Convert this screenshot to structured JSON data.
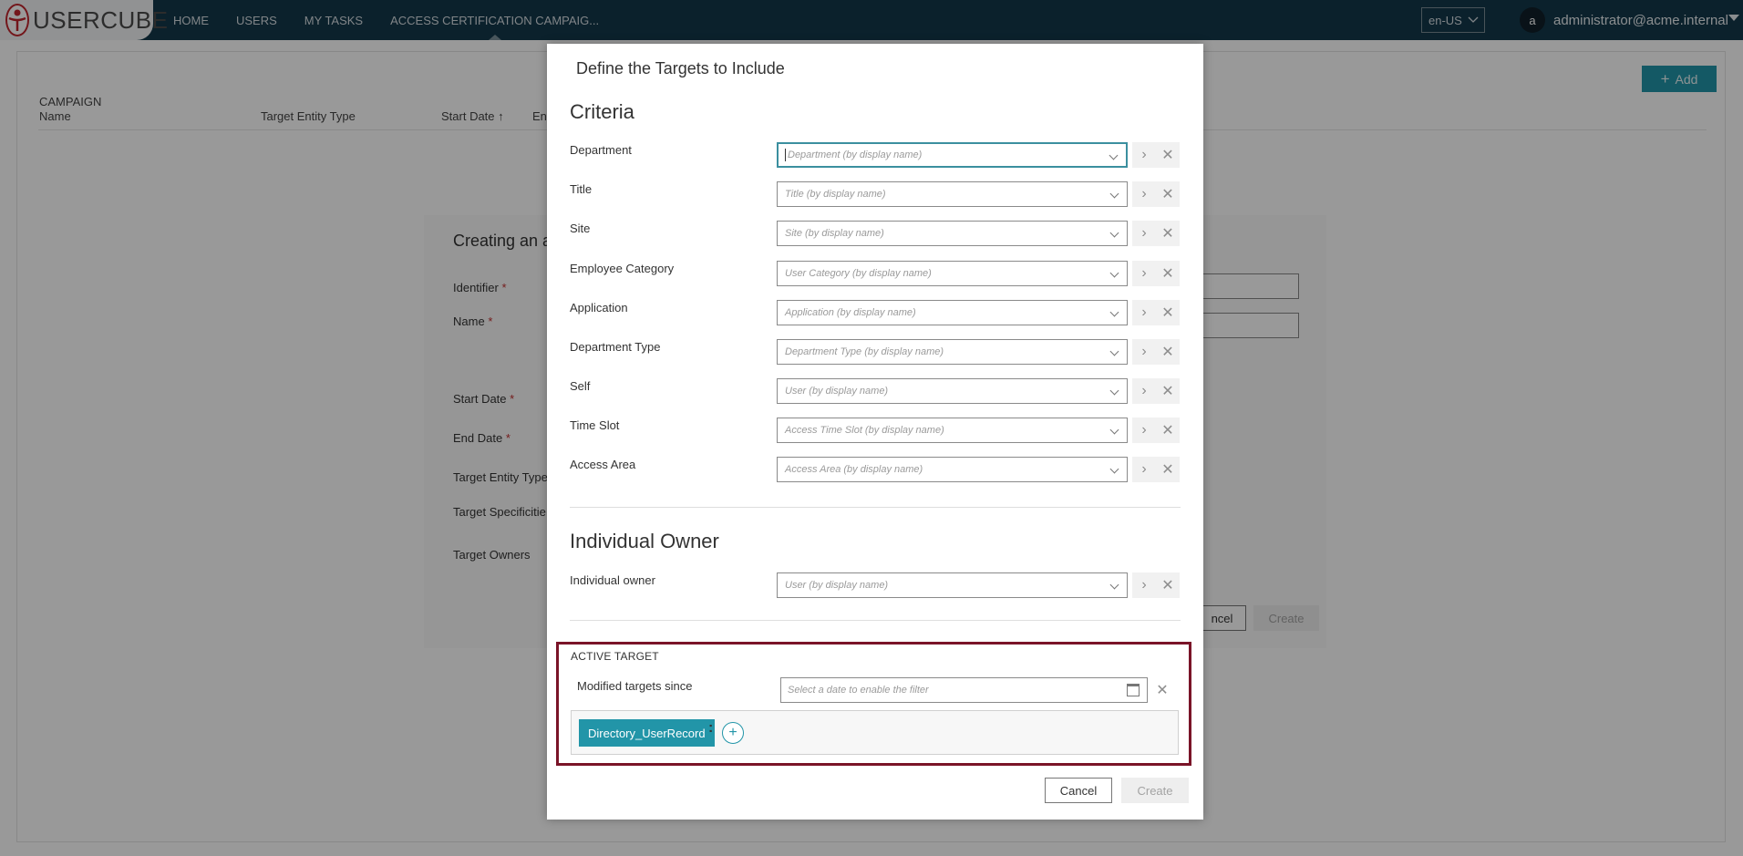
{
  "topbar": {
    "logo_text": "USERCUBE",
    "nav": [
      "HOME",
      "USERS",
      "MY TASKS",
      "ACCESS CERTIFICATION CAMPAIG..."
    ],
    "language": "en-US",
    "avatar_initial": "a",
    "user": "administrator@acme.internal"
  },
  "background": {
    "add_label": "Add",
    "campaign_header": "CAMPAIGN",
    "columns": [
      "Name",
      "Target Entity Type",
      "Start Date",
      "En"
    ],
    "sort_indicator": "↑"
  },
  "middle_dialog": {
    "title": "Creating an a",
    "labels": [
      "Identifier",
      "Name",
      "Start Date",
      "End Date",
      "Target Entity Type",
      "Target Specificitie",
      "Target Owners"
    ],
    "required_marker": "*",
    "cancel_label": "ncel",
    "create_label": "Create"
  },
  "dialog": {
    "title": "Define the Targets to Include",
    "criteria_title": "Criteria",
    "criteria": [
      {
        "label": "Department",
        "placeholder": "Department (by display name)"
      },
      {
        "label": "Title",
        "placeholder": "Title (by display name)"
      },
      {
        "label": "Site",
        "placeholder": "Site (by display name)"
      },
      {
        "label": "Employee Category",
        "placeholder": "User Category (by display name)"
      },
      {
        "label": "Application",
        "placeholder": "Application (by display name)"
      },
      {
        "label": "Department Type",
        "placeholder": "Department Type (by display name)"
      },
      {
        "label": "Self",
        "placeholder": "User (by display name)"
      },
      {
        "label": "Time Slot",
        "placeholder": "Access Time Slot (by display name)"
      },
      {
        "label": "Access Area",
        "placeholder": "Access Area (by display name)"
      }
    ],
    "owner_title": "Individual Owner",
    "owner": {
      "label": "Individual owner",
      "placeholder": "User (by display name)"
    },
    "active_target": {
      "title": "ACTIVE TARGET",
      "modified_label": "Modified targets since",
      "date_placeholder": "Select a date to enable the filter",
      "chip": "Directory_UserRecord",
      "colon": ":"
    },
    "cancel_label": "Cancel",
    "create_label": "Create"
  }
}
